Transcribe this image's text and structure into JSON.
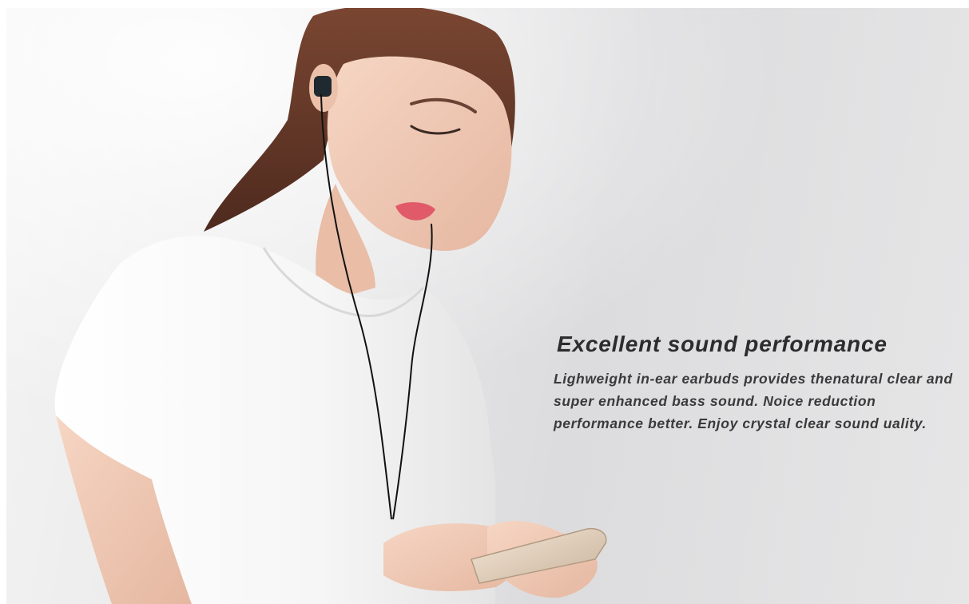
{
  "banner": {
    "headline": "Excellent sound performance",
    "body": "Lighweight in-ear earbuds provides thenatural clear and super enhanced bass sound. Noice reduction performance better. Enjoy crystal clear sound uality."
  },
  "colors": {
    "background": "#e1e1e3",
    "text": "#2f2f31",
    "shirt": "#f7f7f7",
    "hair": "#6a3a2a",
    "skin": "#efc9b3"
  },
  "icons": {
    "earphone": "earphone-icon",
    "phone": "smartphone-icon"
  }
}
